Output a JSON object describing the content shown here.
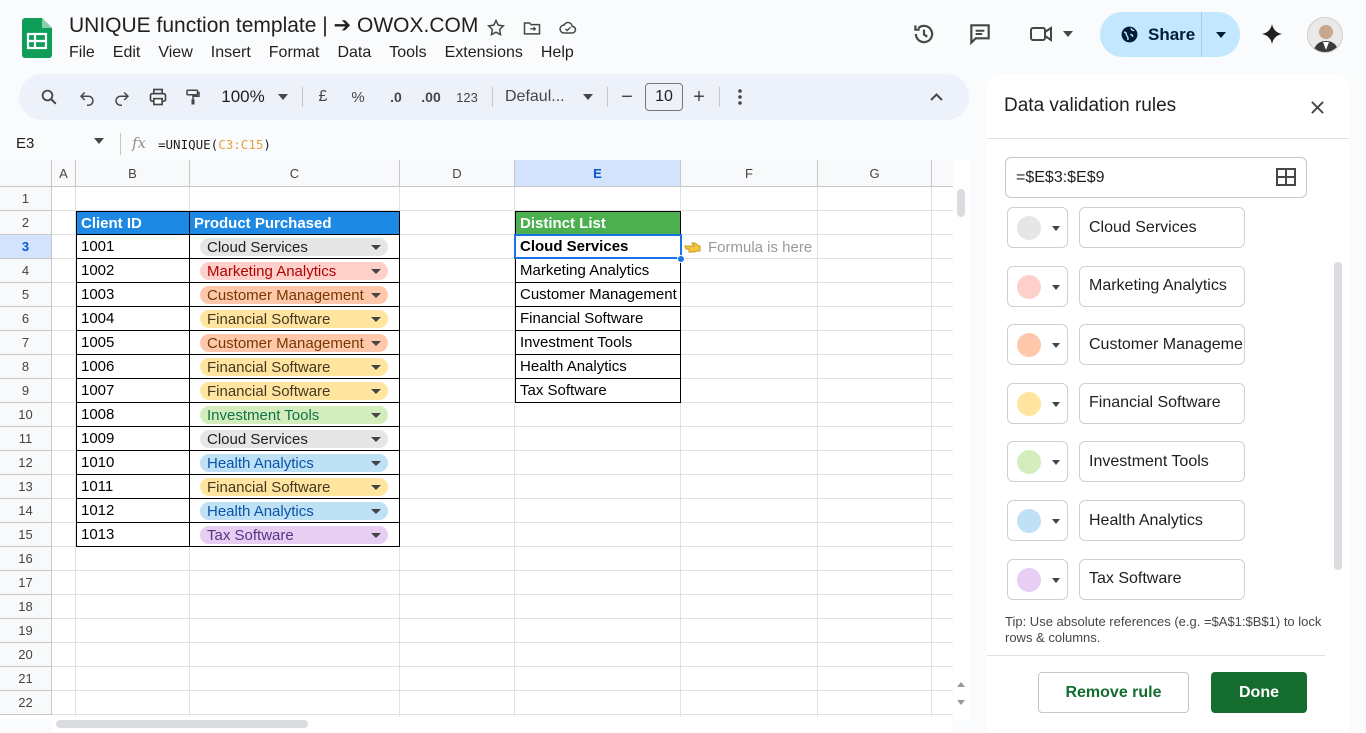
{
  "doc": {
    "title": "UNIQUE function template | ➔ OWOX.COM",
    "menu": [
      "File",
      "Edit",
      "View",
      "Insert",
      "Format",
      "Data",
      "Tools",
      "Extensions",
      "Help"
    ],
    "share_label": "Share"
  },
  "toolbar": {
    "zoom": "100%",
    "currency": "£",
    "percent": "%",
    "dec_decrease": ".0",
    "dec_increase": ".00",
    "number_format": "123",
    "font": "Defaul...",
    "font_size": "10",
    "minus": "−",
    "plus": "+"
  },
  "formula_bar": {
    "cell_ref": "E3",
    "fx": "fx",
    "formula_prefix": "=UNIQUE(",
    "formula_range": "C3:C15",
    "formula_suffix": ")"
  },
  "sheet": {
    "columns": [
      "A",
      "B",
      "C",
      "D",
      "E",
      "F",
      "G"
    ],
    "rows": [
      "1",
      "2",
      "3",
      "4",
      "5",
      "6",
      "7",
      "8",
      "9",
      "10",
      "11",
      "12",
      "13",
      "14",
      "15",
      "16",
      "17",
      "18",
      "19",
      "20",
      "21",
      "22"
    ],
    "selected_cell": "E3",
    "headers": {
      "client_id": "Client ID",
      "product": "Product Purchased",
      "distinct": "Distinct List"
    },
    "records": [
      {
        "id": "1001",
        "product": "Cloud Services",
        "color": "#e6e6e6",
        "text": "#1f1f1f"
      },
      {
        "id": "1002",
        "product": "Marketing Analytics",
        "color": "#ffcfc9",
        "text": "#b10202"
      },
      {
        "id": "1003",
        "product": "Customer Management",
        "color": "#ffc8aa",
        "text": "#753800"
      },
      {
        "id": "1004",
        "product": "Financial Software",
        "color": "#ffe5a0",
        "text": "#473821"
      },
      {
        "id": "1005",
        "product": "Customer Management",
        "color": "#ffc8aa",
        "text": "#753800"
      },
      {
        "id": "1006",
        "product": "Financial Software",
        "color": "#ffe5a0",
        "text": "#473821"
      },
      {
        "id": "1007",
        "product": "Financial Software",
        "color": "#ffe5a0",
        "text": "#473821"
      },
      {
        "id": "1008",
        "product": "Investment Tools",
        "color": "#d4edbc",
        "text": "#11734b"
      },
      {
        "id": "1009",
        "product": "Cloud Services",
        "color": "#e6e6e6",
        "text": "#1f1f1f"
      },
      {
        "id": "1010",
        "product": "Health Analytics",
        "color": "#bfe1f6",
        "text": "#0a53a8"
      },
      {
        "id": "1011",
        "product": "Financial Software",
        "color": "#ffe5a0",
        "text": "#473821"
      },
      {
        "id": "1012",
        "product": "Health Analytics",
        "color": "#bfe1f6",
        "text": "#0a53a8"
      },
      {
        "id": "1013",
        "product": "Tax Software",
        "color": "#e6cff2",
        "text": "#5a3286"
      }
    ],
    "distinct_list": [
      "Cloud Services",
      "Marketing Analytics",
      "Customer Management",
      "Financial Software",
      "Investment Tools",
      "Health Analytics",
      "Tax Software"
    ],
    "note": "Formula is here",
    "colors": {
      "client_header": "#1e88e5",
      "distinct_header": "#4caf50"
    }
  },
  "panel": {
    "title": "Data validation rules",
    "range": "=$E$3:$E$9",
    "options": [
      {
        "label": "Cloud Services",
        "color": "#e6e6e6"
      },
      {
        "label": "Marketing Analytics",
        "color": "#ffcfc9"
      },
      {
        "label": "Customer Management",
        "color": "#ffc8aa"
      },
      {
        "label": "Financial Software",
        "color": "#ffe5a0"
      },
      {
        "label": "Investment Tools",
        "color": "#d4edbc"
      },
      {
        "label": "Health Analytics",
        "color": "#bfe1f6"
      },
      {
        "label": "Tax Software",
        "color": "#e6cff2"
      }
    ],
    "tip": "Tip: Use absolute references (e.g. =$A$1:$B$1) to lock rows & columns.",
    "remove_label": "Remove rule",
    "done_label": "Done"
  }
}
